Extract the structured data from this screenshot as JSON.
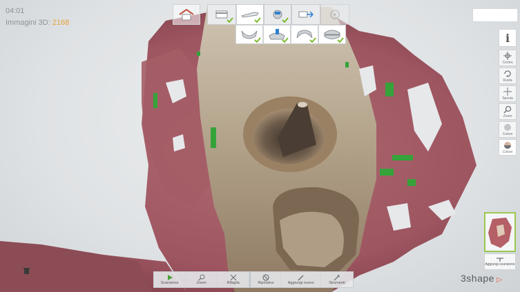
{
  "status": {
    "timer": "04:01",
    "images_label": "Immagini 3D:",
    "images_count": "2168"
  },
  "brand": {
    "name": "3shape",
    "accent": "#e0543a"
  },
  "colors": {
    "check": "#7dbb2f",
    "thumb_border": "#9bc84f",
    "count": "#e7a23a"
  },
  "workflow": {
    "steps": [
      "home-icon",
      "card-icon",
      "scanner-wand-icon",
      "teeth-scan-icon",
      "send-icon",
      "settings-icon"
    ],
    "sub_steps": [
      "upper-jaw-icon",
      "preparation-icon",
      "lower-jaw-icon",
      "bite-icon"
    ]
  },
  "side_tools": {
    "info": "i",
    "center": "Centra",
    "rotate": "Ruota",
    "move": "Sposta",
    "zoom": "Zoom",
    "color1": "Colore",
    "color2": "Colore",
    "add_scan": "Aggiungi scansione"
  },
  "bottom_tools": {
    "scan": "Scansione",
    "zoom": "Zoom",
    "trim": "Rifaglia",
    "reset": "Ripristina",
    "add_new": "Aggiungi nuovo",
    "tools": "Strumenti"
  }
}
